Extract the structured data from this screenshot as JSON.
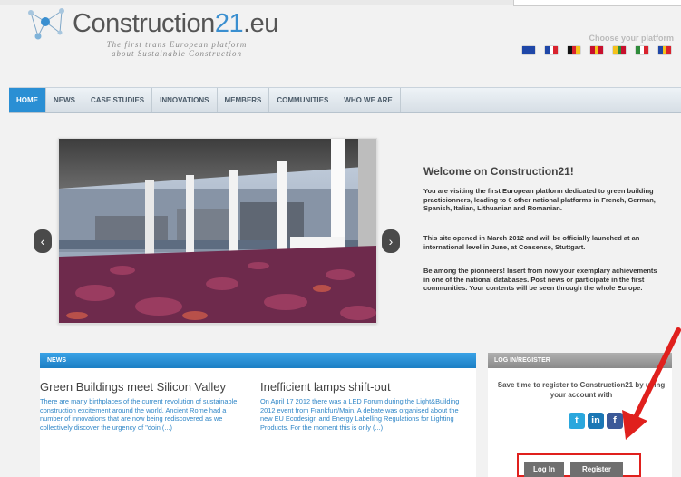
{
  "header": {
    "logo_main": "Construction",
    "logo_num": "21",
    "logo_suffix": ".eu",
    "tagline_1": "The first trans European platform",
    "tagline_2": "about Sustainable Construction",
    "platform_label": "Choose your platform",
    "flags": [
      {
        "name": "eu-flag-icon",
        "colors": [
          "#1f47a8",
          "#1f47a8",
          "#1f47a8"
        ]
      },
      {
        "name": "france-flag-icon",
        "colors": [
          "#1f47a8",
          "#ffffff",
          "#d9232e"
        ]
      },
      {
        "name": "germany-flag-icon",
        "colors": [
          "#111111",
          "#d9232e",
          "#f4c21b"
        ]
      },
      {
        "name": "spain-flag-icon",
        "colors": [
          "#c8102e",
          "#f4c21b",
          "#c8102e"
        ]
      },
      {
        "name": "lithuania-flag-icon",
        "colors": [
          "#f4c21b",
          "#2e8b3a",
          "#c8102e"
        ]
      },
      {
        "name": "italy-flag-icon",
        "colors": [
          "#2e8b3a",
          "#ffffff",
          "#d9232e"
        ]
      },
      {
        "name": "romania-flag-icon",
        "colors": [
          "#1f47a8",
          "#f4c21b",
          "#d9232e"
        ]
      }
    ]
  },
  "nav": {
    "items": [
      "HOME",
      "NEWS",
      "CASE STUDIES",
      "INNOVATIONS",
      "MEMBERS",
      "COMMUNITIES",
      "WHO WE ARE"
    ],
    "active": "HOME"
  },
  "slider": {
    "prev_glyph": "‹",
    "next_glyph": "›"
  },
  "welcome": {
    "title": "Welcome on Construction21!",
    "p1": "You are visiting the first European platform dedicated to green building practicionners, leading to 6 other national platforms in French, German, Spanish, Italian, Lithuanian and Romanian.",
    "p2": "This site opened in March 2012 and will be officially launched at an international level in June, at Consense, Stuttgart.",
    "p3": "Be among the pionneers! Insert from now your exemplary achievements in one of the national databases. Post news or participate in the first communities. Your contents will be seen through the whole Europe."
  },
  "news": {
    "header": "NEWS",
    "articles": [
      {
        "title": "Green Buildings meet Silicon Valley",
        "excerpt": "There are many birthplaces of the current revolution of sustainable construction excitement around the world.   Ancient Rome had a number of innovations that are now being rediscovered as we collectively discover the urgency of \"doin (...)"
      },
      {
        "title": "Inefficient lamps shift-out",
        "excerpt": "On April 17 2012 there was a LED Forum during  the Light&Building 2012 event from Frankfurt/Main. A debate was organised about the new EU Ecodesign and Energy Labelling Regulations for Lighting Products. For the moment this is only (...)"
      }
    ]
  },
  "login": {
    "header": "LOG IN/REGISTER",
    "text": "Save time to register to Construction21 by using your account with",
    "social": {
      "twitter": "t",
      "linkedin": "in",
      "facebook": "f"
    },
    "login_label": "Log In",
    "register_label": "Register"
  },
  "colors": {
    "accent": "#2a8fd4",
    "highlight": "#e0201d"
  }
}
